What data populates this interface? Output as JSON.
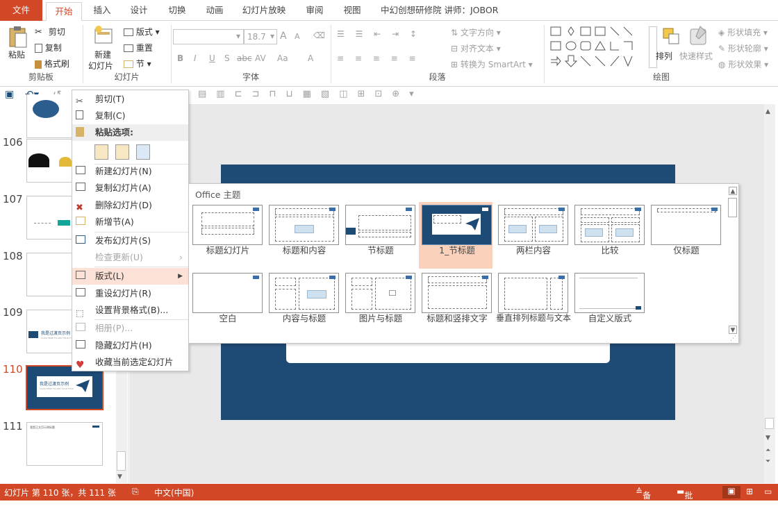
{
  "window": {
    "title": "中幻创想研修院 讲师：JOBOR"
  },
  "tabs": [
    "文件",
    "开始",
    "插入",
    "设计",
    "切换",
    "动画",
    "幻灯片放映",
    "审阅",
    "视图"
  ],
  "ribbon": {
    "clipboard": {
      "label": "剪贴板",
      "paste": "粘贴",
      "cut": "剪切",
      "copy": "复制",
      "format_painter": "格式刷"
    },
    "slides": {
      "label": "幻灯片",
      "new_slide_line1": "新建",
      "new_slide_line2": "幻灯片",
      "layout": "版式",
      "reset": "重置",
      "section": "节"
    },
    "font": {
      "label": "字体",
      "size": "18.7",
      "bold": "B",
      "italic": "I",
      "underline": "U",
      "shadow": "S",
      "strike": "abc",
      "spacing": "AV",
      "case": "Aa",
      "color": "A",
      "grow": "A",
      "shrink": "A"
    },
    "paragraph": {
      "label": "段落",
      "text_direction": "文字方向",
      "align_text": "对齐文本",
      "smartart": "转换为 SmartArt"
    },
    "drawing": {
      "label": "绘图",
      "arrange": "排列",
      "quick_styles": "快速样式",
      "shape_fill": "形状填充",
      "shape_outline": "形状轮廓",
      "shape_effects": "形状效果"
    }
  },
  "thumbnails": [
    {
      "num": "106"
    },
    {
      "num": "107"
    },
    {
      "num": "108"
    },
    {
      "num": "109",
      "text": "我是过渡页示例",
      "sub": "CLICK HERE TO ADD YOUR TITLE"
    },
    {
      "num": "110",
      "text": "我是过渡页示例",
      "sub": "CLICK HERE TO ADD YOUR TITLE"
    },
    {
      "num": "111",
      "text": "我是正文页示例标题"
    }
  ],
  "context_menu": {
    "cut": "剪切(T)",
    "copy": "复制(C)",
    "paste_options": "粘贴选项:",
    "new_slide": "新建幻灯片(N)",
    "duplicate": "复制幻灯片(A)",
    "delete": "删除幻灯片(D)",
    "add_section": "新增节(A)",
    "publish": "发布幻灯片(S)",
    "check_updates": "检查更新(U)",
    "layout": "版式(L)",
    "reset": "重设幻灯片(R)",
    "format_bg": "设置背景格式(B)...",
    "photo_album": "相册(P)...",
    "hide": "隐藏幻灯片(H)",
    "favorite": "收藏当前选定幻灯片"
  },
  "layout_gallery": {
    "title": "Office 主题",
    "items": [
      "标题幻灯片",
      "标题和内容",
      "节标题",
      "1_节标题",
      "两栏内容",
      "比较",
      "仅标题",
      "空白",
      "内容与标题",
      "图片与标题",
      "标题和竖排文字",
      "垂直排列标题与文本",
      "自定义版式"
    ],
    "selected": "1_节标题"
  },
  "status": {
    "slide_info": "幻灯片 第 110 张，共 111 张",
    "language": "中文(中国)",
    "notes": "备注",
    "comments": "批注"
  },
  "colors": {
    "accent": "#d24726",
    "slide_bg": "#1e4a76",
    "highlight": "#fbe1d6"
  }
}
